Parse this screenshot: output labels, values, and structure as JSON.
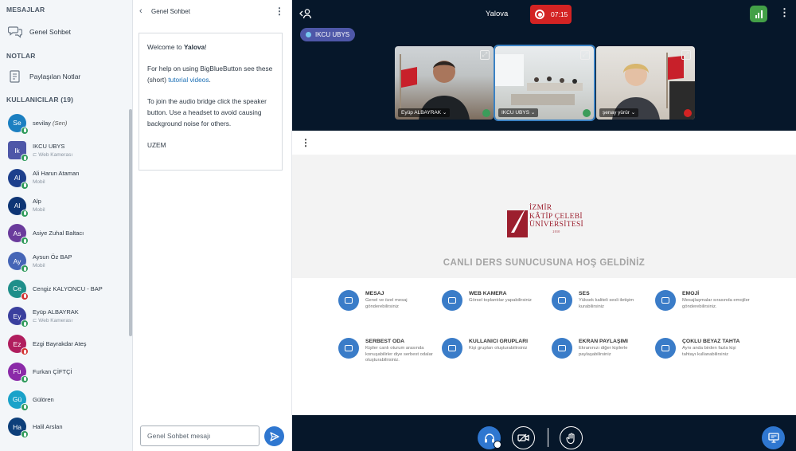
{
  "sidebar": {
    "messages_title": "MESAJLAR",
    "public_chat": "Genel Sohbet",
    "notes_title": "NOTLAR",
    "shared_notes": "Paylaşılan Notlar",
    "users_title": "KULLANICILAR (19)",
    "users": [
      {
        "initials": "Se",
        "name": "sevilay",
        "you": "(Sen)",
        "sub": "",
        "color": "#1b7fc1",
        "status": "#2f9b5b"
      },
      {
        "initials": "Ik",
        "name": "IKCU UBYS",
        "you": "",
        "sub": "⊏ Web Kamerası",
        "color": "#4e57a8",
        "status": "#2f9b5b"
      },
      {
        "initials": "Al",
        "name": "Ali Harun Ataman",
        "you": "",
        "sub": "Mobil",
        "color": "#1d3f8c",
        "status": "#2f9b5b"
      },
      {
        "initials": "Al",
        "name": "Alp",
        "you": "",
        "sub": "Mobil",
        "color": "#0e3575",
        "status": "#2f9b5b"
      },
      {
        "initials": "As",
        "name": "Asiye Zuhal Baltacı",
        "you": "",
        "sub": "",
        "color": "#6a3b9c",
        "status": "#2f9b5b"
      },
      {
        "initials": "Ay",
        "name": "Aysun Öz BAP",
        "you": "",
        "sub": "Mobil",
        "color": "#4565b6",
        "status": "#2f9b5b"
      },
      {
        "initials": "Ce",
        "name": "Cengiz KALYONCU - BAP",
        "you": "",
        "sub": "",
        "color": "#1f8f8a",
        "status": "#d33434"
      },
      {
        "initials": "Ey",
        "name": "Eyüp ALBAYRAK",
        "you": "",
        "sub": "⊏ Web Kamerası",
        "color": "#3a3f9e",
        "status": "#2f9b5b"
      },
      {
        "initials": "Ez",
        "name": "Ezgi Bayrakdar Ateş",
        "you": "",
        "sub": "",
        "color": "#b01e5e",
        "status": "#d33434"
      },
      {
        "initials": "Fu",
        "name": "Furkan ÇİFTÇİ",
        "you": "",
        "sub": "",
        "color": "#8b2aa8",
        "status": "#2f9b5b"
      },
      {
        "initials": "Gü",
        "name": "Gülören",
        "you": "",
        "sub": "",
        "color": "#1aa2c9",
        "status": "#2f9b5b"
      },
      {
        "initials": "Ha",
        "name": "Halil Arslan",
        "you": "",
        "sub": "",
        "color": "#0d3f7a",
        "status": "#2f9b5b"
      }
    ]
  },
  "chat": {
    "title": "Genel Sohbet",
    "welcome_1a": "Welcome to ",
    "welcome_1b": "Yalova",
    "welcome_1c": "!",
    "welcome_2a": "For help on using BigBlueButton see these (short) ",
    "welcome_2b": "tutorial videos",
    "welcome_2c": ".",
    "welcome_3": "To join the audio bridge click the speaker button. Use a headset to avoid causing background noise for others.",
    "welcome_4": "UZEM",
    "input_placeholder": "Genel Sohbet mesajı"
  },
  "topbar": {
    "title": "Yalova",
    "timer": "07:15"
  },
  "speaker": "IKCU UBYS",
  "videos": [
    {
      "label": "Eyüp ALBAYRAK ⌄",
      "muted": false
    },
    {
      "label": "IKCU UBYS ⌄",
      "muted": false
    },
    {
      "label": "şenay yürür ⌄",
      "muted": true
    }
  ],
  "presentation": {
    "logo_lines": [
      "İZMİR",
      "KÂTİP ÇELEBİ",
      "ÜNİVERSİTESİ"
    ],
    "logo_year": "2010",
    "welcome": "CANLI DERS SUNUCUSUNA HOŞ GELDİNİZ",
    "features": [
      {
        "title": "MESAJ",
        "desc": "Genel ve özel mesaj gönderebilirsiniz"
      },
      {
        "title": "WEB KAMERA",
        "desc": "Görsel toplantılar yapabilirsiniz"
      },
      {
        "title": "SES",
        "desc": "Yüksek kaliteli sesli iletişim kurabilirsiniz"
      },
      {
        "title": "EMOJİ",
        "desc": "Mesajlaşmalar sırasında emojiler gönderebilirsiniz."
      },
      {
        "title": "SERBEST ODA",
        "desc": "Kişiler canlı oturum arasında konuşabilirler diye serbest odalar oluşturabilirsiniz."
      },
      {
        "title": "KULLANICI GRUPLARI",
        "desc": "Kişi grupları oluşturabilirsiniz"
      },
      {
        "title": "EKRAN PAYLAŞIMI",
        "desc": "Ekranınızı diğer kişilerle paylaşabilirsiniz"
      },
      {
        "title": "ÇOKLU BEYAZ TAHTA",
        "desc": "Aynı anda birden fazla kişi tahtayı kullanabilirsiniz"
      }
    ]
  }
}
